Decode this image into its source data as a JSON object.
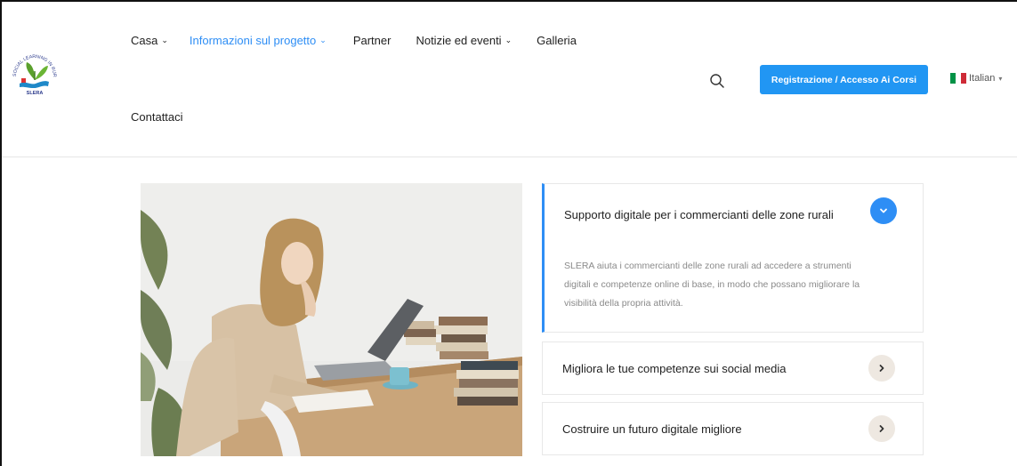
{
  "header": {
    "logo": {
      "name": "SLERA",
      "ring_text": "SOCIAL LEARNING IN RURAL AREAS"
    },
    "nav": [
      {
        "label": "Casa",
        "has_dropdown": true,
        "active": false
      },
      {
        "label": "Informazioni sul progetto",
        "has_dropdown": true,
        "active": true
      },
      {
        "label": "Partner",
        "has_dropdown": false,
        "active": false
      },
      {
        "label": "Notizie ed eventi",
        "has_dropdown": true,
        "active": false
      },
      {
        "label": "Galleria",
        "has_dropdown": false,
        "active": false
      },
      {
        "label": "Contattaci",
        "has_dropdown": false,
        "active": false
      }
    ],
    "search_icon": "search-icon",
    "cta_label": "Registrazione / Accesso Ai Corsi",
    "language": {
      "label": "Italian",
      "flag": "italy-flag-icon"
    }
  },
  "colors": {
    "accent": "#2e8ef5",
    "cta": "#2196f3",
    "toggle_closed": "#eee8e1",
    "body_text": "#8a8a8a"
  },
  "hero_image": {
    "alt": "woman studying with laptop and books"
  },
  "accordion": [
    {
      "title": "Supporto digitale per i commercianti delle zone rurali",
      "body": "SLERA aiuta i commercianti delle zone rurali ad accedere a strumenti digitali e competenze online di base, in modo che possano migliorare la visibilità della propria attività.",
      "open": true,
      "icon": "chevron-down-icon"
    },
    {
      "title": "Migliora le tue competenze sui social media",
      "open": false,
      "icon": "chevron-right-icon"
    },
    {
      "title": "Costruire un futuro digitale migliore",
      "open": false,
      "icon": "chevron-right-icon"
    }
  ]
}
